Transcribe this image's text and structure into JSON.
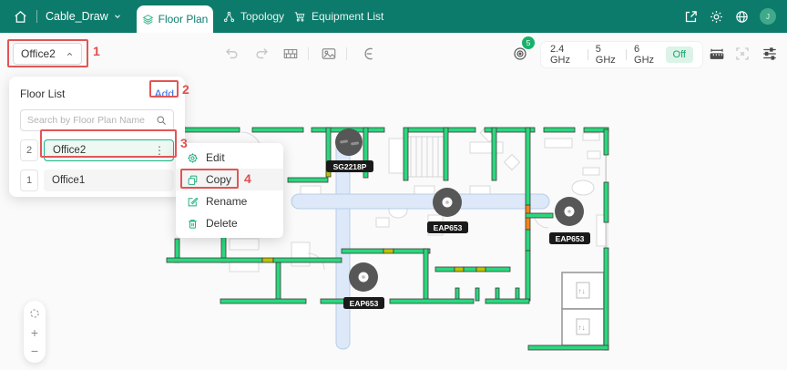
{
  "header": {
    "project": "Cable_Draw",
    "tabs": [
      {
        "label": "Floor Plan"
      },
      {
        "label": "Topology"
      },
      {
        "label": "Equipment List"
      }
    ]
  },
  "toolbar": {
    "floor_selector_value": "Office2",
    "ap_badge_count": "5",
    "bands": [
      "2.4 GHz",
      "5 GHz",
      "6 GHz"
    ],
    "heatmap_state": "Off"
  },
  "floor_list": {
    "title": "Floor List",
    "add_label": "Add",
    "search_placeholder": "Search by Floor Plan Name",
    "rows": [
      {
        "index": "2",
        "name": "Office2"
      },
      {
        "index": "1",
        "name": "Office1"
      }
    ]
  },
  "context_menu": {
    "items": [
      {
        "label": "Edit"
      },
      {
        "label": "Copy"
      },
      {
        "label": "Rename"
      },
      {
        "label": "Delete"
      }
    ]
  },
  "annotations": {
    "step1": "1",
    "step2": "2",
    "step3": "3",
    "step4": "4"
  },
  "devices": [
    {
      "label": "SG2218P"
    },
    {
      "label": "EAP653"
    },
    {
      "label": "EAP653"
    },
    {
      "label": "EAP653"
    }
  ],
  "zoom_controls": {
    "zoom_in": "+",
    "zoom_out": "−"
  },
  "colors": {
    "header_teal": "#0d7b6b",
    "wall_green": "#2bd77d",
    "accent_green": "#1fae7d",
    "annotation_red": "#e25555",
    "add_blue": "#2e6be6",
    "off_chip_bg": "#dcf3e7",
    "off_chip_text": "#16a56b"
  }
}
